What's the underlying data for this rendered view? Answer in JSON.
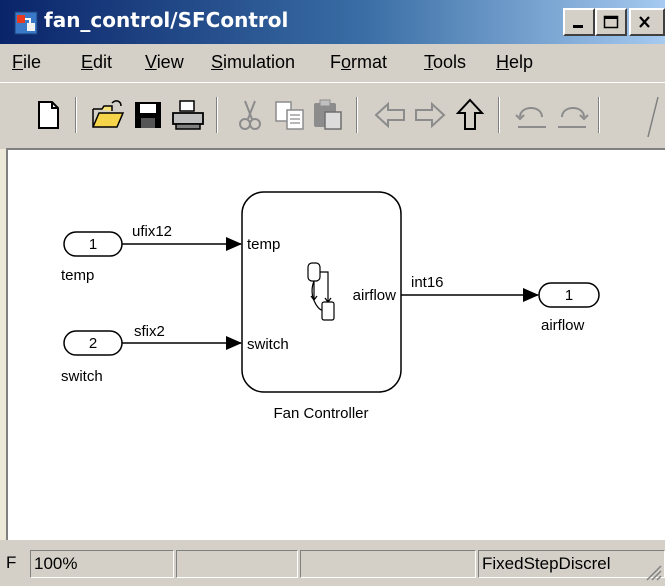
{
  "window": {
    "title": "fan_control/SFControl"
  },
  "menubar": {
    "items": [
      {
        "accel": "F",
        "rest": "ile"
      },
      {
        "accel": "E",
        "rest": "dit"
      },
      {
        "accel": "V",
        "rest": "iew"
      },
      {
        "accel": "S",
        "rest": "imulation"
      },
      {
        "pre": "F",
        "accel": "o",
        "rest": "rmat"
      },
      {
        "accel": "T",
        "rest": "ools"
      },
      {
        "accel": "H",
        "rest": "elp"
      }
    ]
  },
  "toolbar": {
    "buttons": [
      "new-file-icon",
      "open-folder-icon",
      "save-icon",
      "print-icon",
      "cut-icon",
      "copy-icon",
      "paste-icon",
      "back-arrow-icon",
      "forward-arrow-icon",
      "up-arrow-icon",
      "undo-icon",
      "redo-icon"
    ]
  },
  "diagram": {
    "inports": [
      {
        "number": "1",
        "name": "temp",
        "signal_type": "ufix12"
      },
      {
        "number": "2",
        "name": "switch",
        "signal_type": "sfix2"
      }
    ],
    "block": {
      "name": "Fan Controller",
      "inputs": [
        "temp",
        "switch"
      ],
      "output": "airflow"
    },
    "output_signal_type": "int16",
    "outport": {
      "number": "1",
      "name": "airflow"
    }
  },
  "statusbar": {
    "left": "F",
    "zoom": "100%",
    "middle": "",
    "solver": "FixedStepDiscrel"
  }
}
